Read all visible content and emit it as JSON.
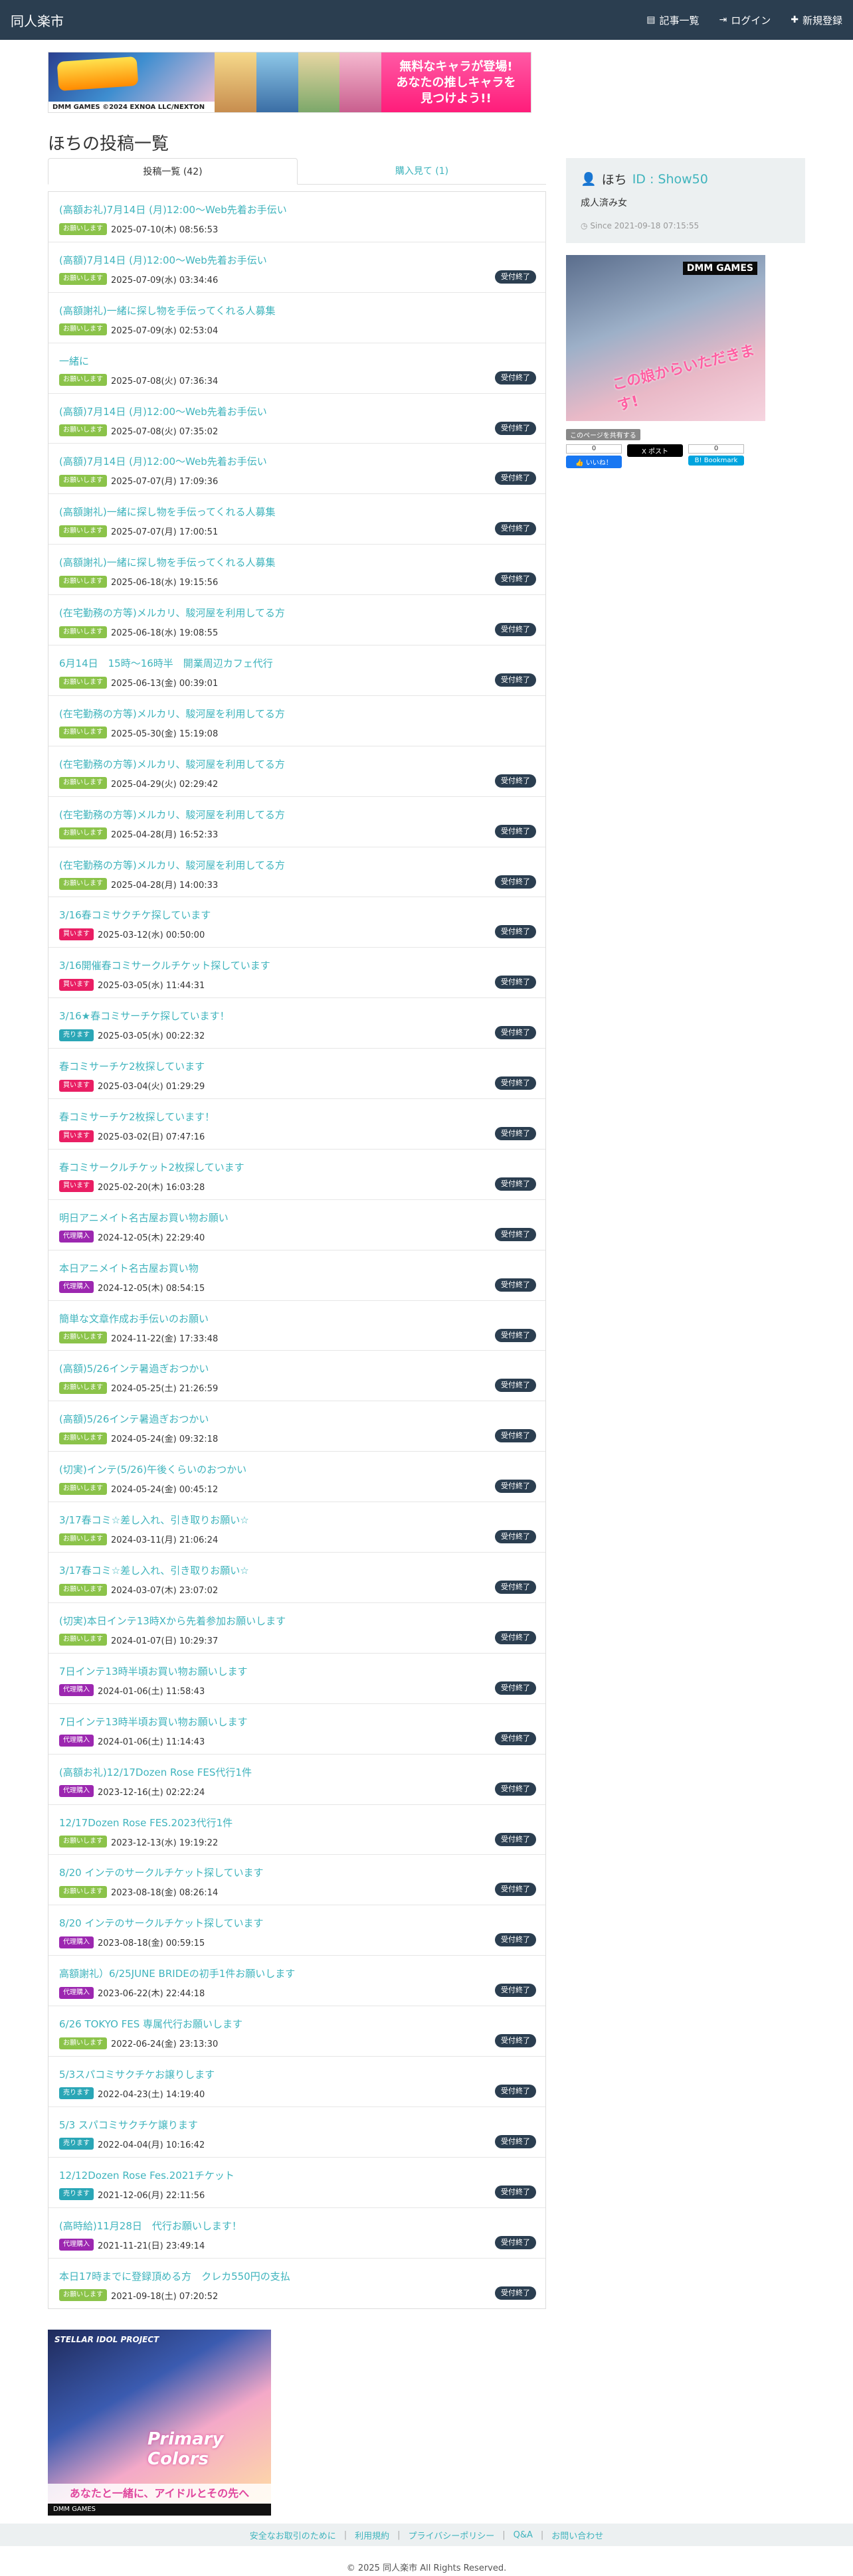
{
  "nav": {
    "brand": "同人楽市",
    "links": [
      {
        "icon": "list-icon",
        "label": "記事一覧"
      },
      {
        "icon": "login-icon",
        "label": "ログイン"
      },
      {
        "icon": "plus-icon",
        "label": "新規登録"
      }
    ]
  },
  "top_banner": {
    "copyright": "DMM GAMES ©2024 EXNOA LLC/NEXTON",
    "tagline_1": "無料なキャラが登場!",
    "tagline_2": "あなたの推しキャラを",
    "tagline_3": "見つけよう!!"
  },
  "page_title": "ほちの投稿一覧",
  "tabs": [
    {
      "label": "投稿一覧 (42)",
      "active": true
    },
    {
      "label": "購入見て (1)",
      "active": false
    }
  ],
  "categories": {
    "onegai": {
      "label": "お願いします",
      "color": "#8bc34a"
    },
    "kaimasu": {
      "label": "買います",
      "color": "#e91e63"
    },
    "urimasu": {
      "label": "売ります",
      "color": "#2aa6b6"
    },
    "daiko": {
      "label": "代理購入",
      "color": "#9c27b0"
    }
  },
  "posts": [
    {
      "title": "(高額お礼)7月14日 (月)12:00〜Web先着お手伝い",
      "cat": "onegai",
      "date": "2025-07-10(木) 08:56:53",
      "status": ""
    },
    {
      "title": "(高額)7月14日 (月)12:00〜Web先着お手伝い",
      "cat": "onegai",
      "date": "2025-07-09(水) 03:34:46",
      "status": "受付終了"
    },
    {
      "title": "(高額謝礼)一緒に探し物を手伝ってくれる人募集",
      "cat": "onegai",
      "date": "2025-07-09(水) 02:53:04",
      "status": ""
    },
    {
      "title": "一緒に",
      "cat": "onegai",
      "date": "2025-07-08(火) 07:36:34",
      "status": "受付終了"
    },
    {
      "title": "(高額)7月14日 (月)12:00〜Web先着お手伝い",
      "cat": "onegai",
      "date": "2025-07-08(火) 07:35:02",
      "status": "受付終了"
    },
    {
      "title": "(高額)7月14日 (月)12:00〜Web先着お手伝い",
      "cat": "onegai",
      "date": "2025-07-07(月) 17:09:36",
      "status": "受付終了"
    },
    {
      "title": "(高額謝礼)一緒に探し物を手伝ってくれる人募集",
      "cat": "onegai",
      "date": "2025-07-07(月) 17:00:51",
      "status": "受付終了"
    },
    {
      "title": "(高額謝礼)一緒に探し物を手伝ってくれる人募集",
      "cat": "onegai",
      "date": "2025-06-18(水) 19:15:56",
      "status": "受付終了"
    },
    {
      "title": "(在宅勤務の方等)メルカリ、駿河屋を利用してる方",
      "cat": "onegai",
      "date": "2025-06-18(水) 19:08:55",
      "status": "受付終了"
    },
    {
      "title": "6月14日　15時〜16時半　開業周辺カフェ代行",
      "cat": "onegai",
      "date": "2025-06-13(金) 00:39:01",
      "status": "受付終了"
    },
    {
      "title": "(在宅勤務の方等)メルカリ、駿河屋を利用してる方",
      "cat": "onegai",
      "date": "2025-05-30(金) 15:19:08",
      "status": ""
    },
    {
      "title": "(在宅勤務の方等)メルカリ、駿河屋を利用してる方",
      "cat": "onegai",
      "date": "2025-04-29(火) 02:29:42",
      "status": "受付終了"
    },
    {
      "title": "(在宅勤務の方等)メルカリ、駿河屋を利用してる方",
      "cat": "onegai",
      "date": "2025-04-28(月) 16:52:33",
      "status": "受付終了"
    },
    {
      "title": "(在宅勤務の方等)メルカリ、駿河屋を利用してる方",
      "cat": "onegai",
      "date": "2025-04-28(月) 14:00:33",
      "status": "受付終了"
    },
    {
      "title": "3/16春コミサクチケ探しています",
      "cat": "kaimasu",
      "date": "2025-03-12(水) 00:50:00",
      "status": "受付終了"
    },
    {
      "title": "3/16開催春コミサークルチケット探しています",
      "cat": "kaimasu",
      "date": "2025-03-05(水) 11:44:31",
      "status": "受付終了"
    },
    {
      "title": "3/16★春コミサーチケ探しています！",
      "cat": "urimasu",
      "date": "2025-03-05(水) 00:22:32",
      "status": "受付終了"
    },
    {
      "title": "春コミサーチケ2枚探しています",
      "cat": "kaimasu",
      "date": "2025-03-04(火) 01:29:29",
      "status": "受付終了"
    },
    {
      "title": "春コミサーチケ2枚探しています！",
      "cat": "kaimasu",
      "date": "2025-03-02(日) 07:47:16",
      "status": "受付終了"
    },
    {
      "title": "春コミサークルチケット2枚探しています",
      "cat": "kaimasu",
      "date": "2025-02-20(木) 16:03:28",
      "status": "受付終了"
    },
    {
      "title": "明日アニメイト名古屋お買い物お願い",
      "cat": "daiko",
      "date": "2024-12-05(木) 22:29:40",
      "status": "受付終了"
    },
    {
      "title": "本日アニメイト名古屋お買い物",
      "cat": "daiko",
      "date": "2024-12-05(木) 08:54:15",
      "status": "受付終了"
    },
    {
      "title": "簡単な文章作成お手伝いのお願い",
      "cat": "onegai",
      "date": "2024-11-22(金) 17:33:48",
      "status": "受付終了"
    },
    {
      "title": "(高額)5/26インテ暑過ぎおつかい",
      "cat": "onegai",
      "date": "2024-05-25(土) 21:26:59",
      "status": "受付終了"
    },
    {
      "title": "(高額)5/26インテ暑過ぎおつかい",
      "cat": "onegai",
      "date": "2024-05-24(金) 09:32:18",
      "status": "受付終了"
    },
    {
      "title": "(切実)インテ(5/26)午後くらいのおつかい",
      "cat": "onegai",
      "date": "2024-05-24(金) 00:45:12",
      "status": "受付終了"
    },
    {
      "title": "3/17春コミ☆差し入れ、引き取りお願い☆",
      "cat": "onegai",
      "date": "2024-03-11(月) 21:06:24",
      "status": "受付終了"
    },
    {
      "title": "3/17春コミ☆差し入れ、引き取りお願い☆",
      "cat": "onegai",
      "date": "2024-03-07(木) 23:07:02",
      "status": "受付終了"
    },
    {
      "title": "(切実)本日インテ13時Xから先着参加お願いします",
      "cat": "onegai",
      "date": "2024-01-07(日) 10:29:37",
      "status": "受付終了"
    },
    {
      "title": "7日インテ13時半頃お買い物お願いします",
      "cat": "daiko",
      "date": "2024-01-06(土) 11:58:43",
      "status": "受付終了"
    },
    {
      "title": "7日インテ13時半頃お買い物お願いします",
      "cat": "daiko",
      "date": "2024-01-06(土) 11:14:43",
      "status": "受付終了"
    },
    {
      "title": "(高額お礼)12/17Dozen Rose FES代行1件",
      "cat": "daiko",
      "date": "2023-12-16(土) 02:22:24",
      "status": "受付終了"
    },
    {
      "title": "12/17Dozen Rose FES.2023代行1件",
      "cat": "onegai",
      "date": "2023-12-13(水) 19:19:22",
      "status": "受付終了"
    },
    {
      "title": "8/20 インテのサークルチケット探しています",
      "cat": "onegai",
      "date": "2023-08-18(金) 08:26:14",
      "status": "受付終了"
    },
    {
      "title": "8/20 インテのサークルチケット探しています",
      "cat": "daiko",
      "date": "2023-08-18(金) 00:59:15",
      "status": "受付終了"
    },
    {
      "title": "高額謝礼）6/25JUNE BRIDEの初手1件お願いします",
      "cat": "daiko",
      "date": "2023-06-22(木) 22:44:18",
      "status": "受付終了"
    },
    {
      "title": "6/26 TOKYO FES 専属代行お願いします",
      "cat": "onegai",
      "date": "2022-06-24(金) 23:13:30",
      "status": "受付終了"
    },
    {
      "title": "5/3スパコミサクチケお譲りします",
      "cat": "urimasu",
      "date": "2022-04-23(土) 14:19:40",
      "status": "受付終了"
    },
    {
      "title": "5/3 スパコミサクチケ譲ります",
      "cat": "urimasu",
      "date": "2022-04-04(月) 10:16:42",
      "status": "受付終了"
    },
    {
      "title": "12/12Dozen Rose Fes.2021チケット",
      "cat": "urimasu",
      "date": "2021-12-06(月) 22:11:56",
      "status": "受付終了"
    },
    {
      "title": "(高時給)11月28日　代行お願いします！",
      "cat": "daiko",
      "date": "2021-11-21(日) 23:49:14",
      "status": "受付終了"
    },
    {
      "title": "本日17時までに登録頂める方　クレカ550円の支払",
      "cat": "onegai",
      "date": "2021-09-18(土) 07:20:52",
      "status": "受付終了"
    }
  ],
  "profile": {
    "name": "ほち",
    "uid": "ID : Show50",
    "desc": "成人済み女",
    "since": "Since 2021-09-18 07:15:55"
  },
  "side_banner": {
    "brand": "DMM GAMES",
    "copy": "この娘からいただきます!"
  },
  "share": {
    "label": "このページを共有する",
    "buttons": [
      {
        "count": "0",
        "label": "いいね！",
        "color": "#1877f2",
        "icon": "thumbs-up-icon"
      },
      {
        "count": "",
        "label": "X ポスト",
        "color": "#000000",
        "icon": "x-icon"
      },
      {
        "count": "0",
        "label": "Bookmark",
        "color": "#00a4de",
        "icon": "bookmark-icon"
      }
    ]
  },
  "bottom_banner": {
    "logo": "STELLAR IDOL PROJECT",
    "title": "Primary Colors",
    "tagline": "あなたと一緒に、アイドルとその先へ",
    "brand": "DMM GAMES"
  },
  "footer": {
    "links": [
      "安全なお取引のために",
      "利用規約",
      "プライバシーポリシー",
      "Q&A",
      "お問い合わせ"
    ],
    "copyright": "© 2025 同人楽市 All Rights Reserved."
  }
}
